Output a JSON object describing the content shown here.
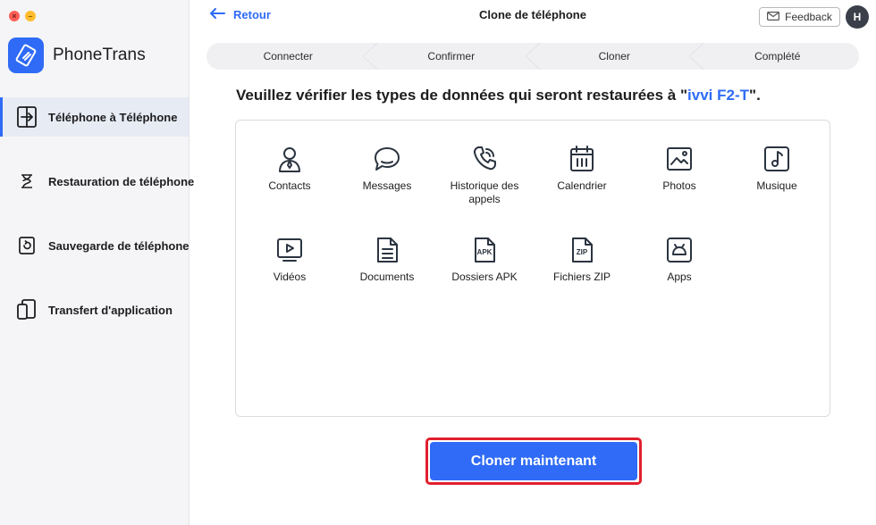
{
  "app": {
    "name": "PhoneTrans"
  },
  "window_controls": {
    "close": "×",
    "minimize": "–"
  },
  "sidebar": {
    "items": [
      {
        "label": "Téléphone à Téléphone",
        "icon": "phone-transfer-icon",
        "active": true
      },
      {
        "label": "Restauration de téléphone",
        "icon": "hourglass-icon",
        "active": false
      },
      {
        "label": "Sauvegarde de téléphone",
        "icon": "backup-icon",
        "active": false
      },
      {
        "label": "Transfert d'application",
        "icon": "app-transfer-icon",
        "active": false
      }
    ]
  },
  "header": {
    "back_label": "Retour",
    "title": "Clone de téléphone",
    "feedback_label": "Feedback",
    "avatar_initial": "H"
  },
  "steps": [
    "Connecter",
    "Confirmer",
    "Cloner",
    "Complété"
  ],
  "main": {
    "heading_prefix": "Veuillez vérifier les types de données qui seront restaurées à \"",
    "device_name": "ivvi F2-T",
    "heading_suffix": "\".",
    "data_types": [
      {
        "label": "Contacts",
        "icon": "contacts-icon"
      },
      {
        "label": "Messages",
        "icon": "messages-icon"
      },
      {
        "label": "Historique des appels",
        "icon": "call-history-icon"
      },
      {
        "label": "Calendrier",
        "icon": "calendar-icon"
      },
      {
        "label": "Photos",
        "icon": "photos-icon"
      },
      {
        "label": "Musique",
        "icon": "music-icon"
      },
      {
        "label": "Vidéos",
        "icon": "videos-icon"
      },
      {
        "label": "Documents",
        "icon": "documents-icon"
      },
      {
        "label": "Dossiers APK",
        "icon": "apk-icon"
      },
      {
        "label": "Fichiers ZIP",
        "icon": "zip-icon"
      },
      {
        "label": "Apps",
        "icon": "apps-icon"
      }
    ],
    "cta_label": "Cloner maintenant"
  },
  "colors": {
    "accent": "#2f6bf6",
    "highlight_border": "#e1202f",
    "icon_stroke": "#2b3440"
  }
}
